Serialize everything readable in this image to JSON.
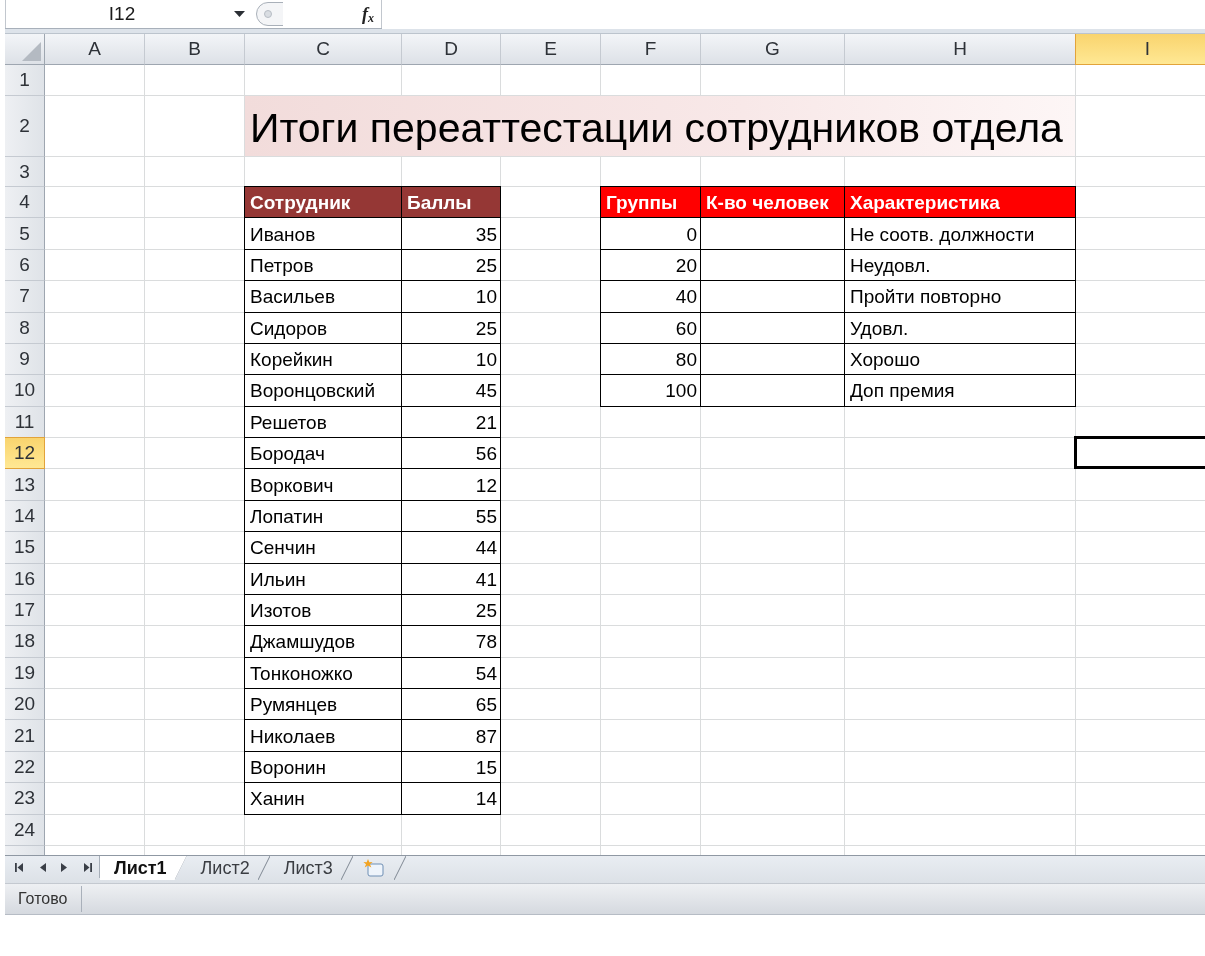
{
  "name_box": {
    "value": "I12"
  },
  "formula_bar": {
    "function_button": "f$_{x}$"
  },
  "columns": [
    {
      "label": "A",
      "selected": false
    },
    {
      "label": "B",
      "selected": false
    },
    {
      "label": "C",
      "selected": false
    },
    {
      "label": "D",
      "selected": false
    },
    {
      "label": "E",
      "selected": false
    },
    {
      "label": "F",
      "selected": false
    },
    {
      "label": "G",
      "selected": false
    },
    {
      "label": "H",
      "selected": false
    },
    {
      "label": "I",
      "selected": true
    }
  ],
  "rows": [
    {
      "label": "1",
      "selected": false
    },
    {
      "label": "2",
      "selected": false
    },
    {
      "label": "3",
      "selected": false
    },
    {
      "label": "4",
      "selected": false
    },
    {
      "label": "5",
      "selected": false
    },
    {
      "label": "6",
      "selected": false
    },
    {
      "label": "7",
      "selected": false
    },
    {
      "label": "8",
      "selected": false
    },
    {
      "label": "9",
      "selected": false
    },
    {
      "label": "10",
      "selected": false
    },
    {
      "label": "11",
      "selected": false
    },
    {
      "label": "12",
      "selected": true
    },
    {
      "label": "13",
      "selected": false
    },
    {
      "label": "14",
      "selected": false
    },
    {
      "label": "15",
      "selected": false
    },
    {
      "label": "16",
      "selected": false
    },
    {
      "label": "17",
      "selected": false
    },
    {
      "label": "18",
      "selected": false
    },
    {
      "label": "19",
      "selected": false
    },
    {
      "label": "20",
      "selected": false
    },
    {
      "label": "21",
      "selected": false
    },
    {
      "label": "22",
      "selected": false
    },
    {
      "label": "23",
      "selected": false
    },
    {
      "label": "24",
      "selected": false
    }
  ],
  "title": "Итоги переаттестации сотрудников отдела",
  "employees_table": {
    "columns": [
      "Сотрудник",
      "Баллы"
    ],
    "rows": [
      {
        "name": "Иванов",
        "score": "35"
      },
      {
        "name": "Петров",
        "score": "25"
      },
      {
        "name": "Васильев",
        "score": "10"
      },
      {
        "name": "Сидоров",
        "score": "25"
      },
      {
        "name": "Корейкин",
        "score": "10"
      },
      {
        "name": "Воронцовский",
        "score": "45"
      },
      {
        "name": "Решетов",
        "score": "21"
      },
      {
        "name": "Бородач",
        "score": "56"
      },
      {
        "name": "Воркович",
        "score": "12"
      },
      {
        "name": "Лопатин",
        "score": "55"
      },
      {
        "name": "Сенчин",
        "score": "44"
      },
      {
        "name": "Ильин",
        "score": "41"
      },
      {
        "name": "Изотов",
        "score": "25"
      },
      {
        "name": "Джамшудов",
        "score": "78"
      },
      {
        "name": "Тонконожко",
        "score": "54"
      },
      {
        "name": "Румянцев",
        "score": "65"
      },
      {
        "name": "Николаев",
        "score": "87"
      },
      {
        "name": "Воронин",
        "score": "15"
      },
      {
        "name": "Ханин",
        "score": "14"
      }
    ]
  },
  "groups_table": {
    "columns": [
      "Группы",
      "К-во человек",
      "Характеристика"
    ],
    "rows": [
      {
        "group": "0",
        "characteristic": "Не соотв. должности"
      },
      {
        "group": "20",
        "characteristic": "Неудовл."
      },
      {
        "group": "40",
        "characteristic": "Пройти повторно"
      },
      {
        "group": "60",
        "characteristic": "Удовл."
      },
      {
        "group": "80",
        "characteristic": "Хорошо"
      },
      {
        "group": "100",
        "characteristic": "Доп премия"
      }
    ]
  },
  "sheet_tabs": [
    {
      "label": "Лист1",
      "selected": true
    },
    {
      "label": "Лист2",
      "selected": false
    },
    {
      "label": "Лист3",
      "selected": false
    }
  ],
  "status_bar": {
    "text": "Готово"
  }
}
